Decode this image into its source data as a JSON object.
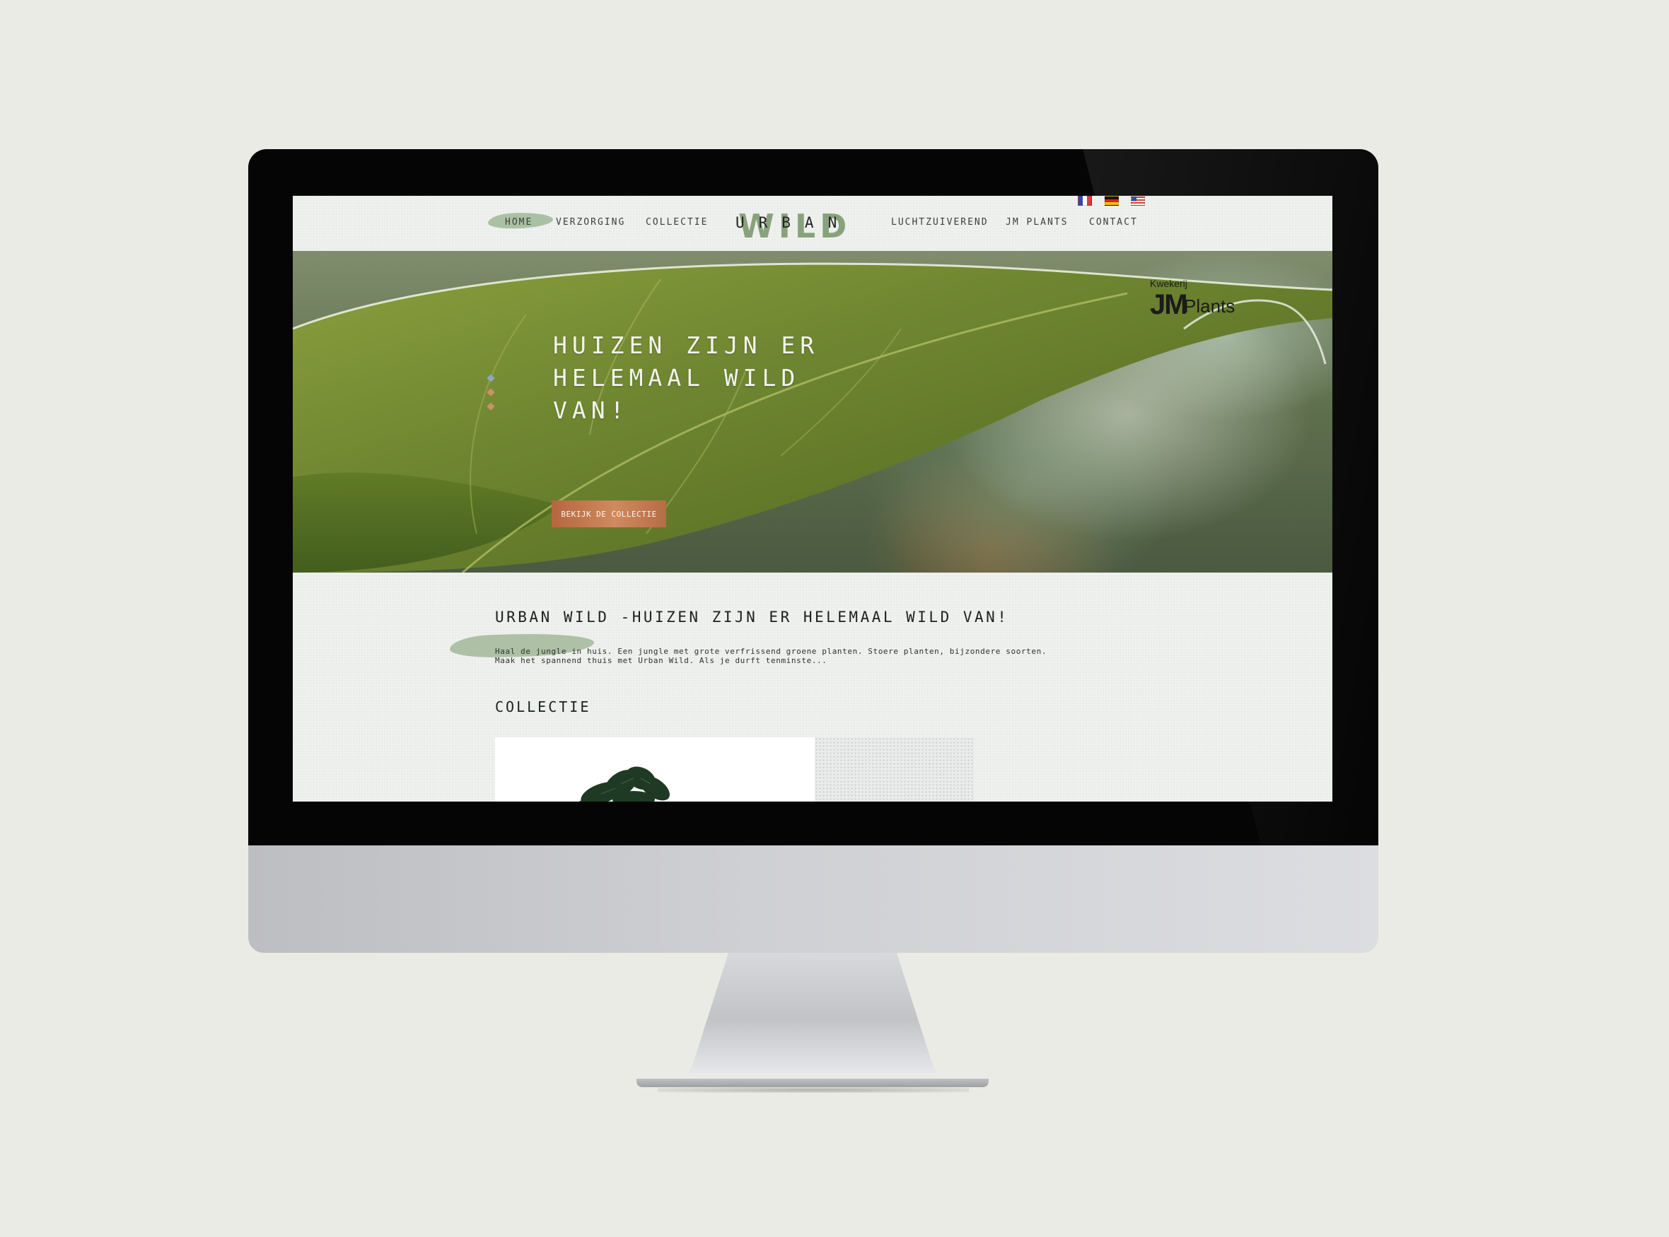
{
  "nav": {
    "items": [
      {
        "label": "HOME",
        "active": true
      },
      {
        "label": "VERZORGING"
      },
      {
        "label": "COLLECTIE"
      },
      {
        "label": "LUCHTZUIVEREND"
      },
      {
        "label": "JM PLANTS"
      },
      {
        "label": "CONTACT"
      }
    ],
    "logo": {
      "top": "URBAN",
      "overlay": "WILD"
    },
    "languages": [
      "fr-flag-icon",
      "de-flag-icon",
      "us-flag-icon"
    ]
  },
  "hero": {
    "title_lines": [
      "HUIZEN ZIJN ER",
      "HELEMAAL WILD",
      "VAN!"
    ],
    "button_label": "BEKIJK DE COLLECTIE",
    "slide_count": 3,
    "active_slide": 1,
    "partner_logo": {
      "small": "Kwekerij",
      "initials": "JM",
      "name": "Plants"
    }
  },
  "intro": {
    "title": "URBAN WILD -HUIZEN ZIJN ER HELEMAAL WILD VAN!",
    "lines": [
      "Haal de jungle in huis. Een jungle met grote verfrissend groene planten.  Stoere planten, bijzondere soorten.",
      "Maak het spannend thuis met Urban Wild. Als je durft tenminste..."
    ]
  },
  "collection": {
    "heading": "COLLECTIE"
  },
  "colors": {
    "accent_green": "#9db593",
    "button_copper": "#c47d54",
    "text_dark": "#1d211d"
  }
}
